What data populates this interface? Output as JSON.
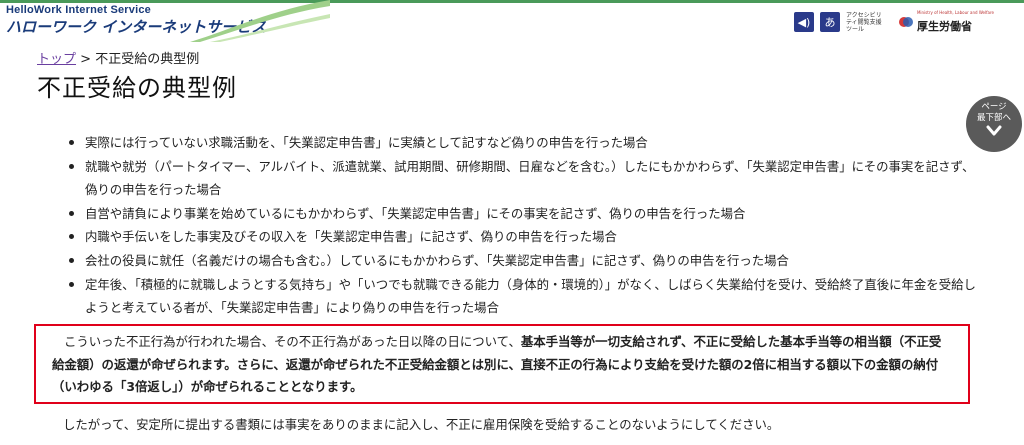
{
  "header": {
    "brand_sub": "HelloWork Internet Service",
    "brand_main": "ハローワーク インターネットサービス",
    "accessibility_tool_label": "アクセシビリティ閲覧支援ツール",
    "ministry_name": "厚生労働省",
    "ministry_small": "Ministry of Health, Labour and Welfare",
    "accent_color": "#4a9a5a",
    "brand_color": "#1a3b7a"
  },
  "breadcrumb": {
    "home_label": "トップ",
    "separator": " > ",
    "current": "不正受給の典型例"
  },
  "page": {
    "title": "不正受給の典型例"
  },
  "bullets": [
    "実際には行っていない求職活動を、「失業認定申告書」に実績として記すなど偽りの申告を行った場合",
    "就職や就労（パートタイマー、アルバイト、派遣就業、試用期間、研修期間、日雇などを含む。）したにもかかわらず、「失業認定申告書」にその事実を記さず、偽りの申告を行った場合",
    "自営や請負により事業を始めているにもかかわらず、「失業認定申告書」にその事実を記さず、偽りの申告を行った場合",
    "内職や手伝いをした事実及びその収入を「失業認定申告書」に記さず、偽りの申告を行った場合",
    "会社の役員に就任（名義だけの場合も含む。）しているにもかかわらず、「失業認定申告書」に記さず、偽りの申告を行った場合",
    "定年後、「積極的に就職しようとする気持ち」や「いつでも就職できる能力（身体的・環境的）」がなく、しばらく失業給付を受け、受給終了直後に年金を受給しようと考えている者が、「失業認定申告書」により偽りの申告を行った場合"
  ],
  "notice": {
    "intro": "こういった不正行為が行われた場合、その不正行為があった日以降の日について、",
    "bold": "基本手当等が一切支給されず、不正に受給した基本手当等の相当額（不正受給金額）の返還が命ぜられます。さらに、返還が命ぜられた不正受給金額とは別に、直接不正の行為により支給を受けた額の2倍に相当する額以下の金額の納付（いわゆる「3倍返し」）が命ぜられることとなります。",
    "border_color": "#e0001a"
  },
  "closing": "したがって、安定所に提出する書類には事実をありのままに記入し、不正に雇用保険を受給することのないようにしてください。",
  "to_bottom_button": {
    "line1": "ページ",
    "line2": "最下部へ",
    "icon": "chevron-down-icon"
  }
}
